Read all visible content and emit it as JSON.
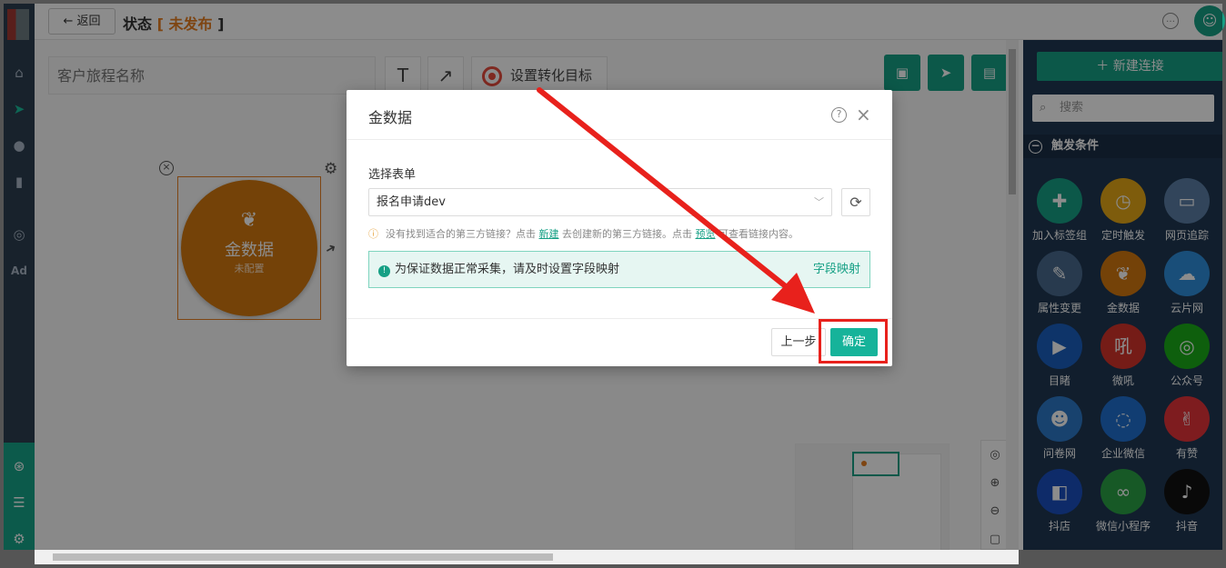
{
  "topbar": {
    "back_label": "返回",
    "title": "状态",
    "status": "未发布",
    "bracket_open": "[",
    "bracket_close": "]"
  },
  "toolbar": {
    "name_placeholder": "客户旅程名称",
    "text_tool": "T",
    "arrow_tool": "↗",
    "goal_label": "设置转化目标"
  },
  "node": {
    "title": "金数据",
    "subtitle": "未配置"
  },
  "right_panel": {
    "new_connection": "新建连接",
    "search_placeholder": "搜索",
    "section_title": "触发条件",
    "items": [
      {
        "label": "加入标签组",
        "icon": "user-plus-icon",
        "color": "#16a085"
      },
      {
        "label": "定时触发",
        "icon": "clock-icon",
        "color": "#e6a817"
      },
      {
        "label": "网页追踪",
        "icon": "browser-icon",
        "color": "#5b7fa6"
      },
      {
        "label": "属性变更",
        "icon": "edit-icon",
        "color": "#4a6b8f"
      },
      {
        "label": "金数据",
        "icon": "leaf-icon",
        "color": "#d4790f"
      },
      {
        "label": "云片网",
        "icon": "cloud-icon",
        "color": "#2f8fdc"
      },
      {
        "label": "目睹",
        "icon": "play-icon",
        "color": "#1a5fbf"
      },
      {
        "label": "微吼",
        "icon": "weihou-icon",
        "color": "#d6332b"
      },
      {
        "label": "公众号",
        "icon": "wechat-icon",
        "color": "#1aad19"
      },
      {
        "label": "问卷网",
        "icon": "survey-icon",
        "color": "#2c79c9"
      },
      {
        "label": "企业微信",
        "icon": "wecom-icon",
        "color": "#1f6fd0"
      },
      {
        "label": "有赞",
        "icon": "thumb-icon",
        "color": "#e5333a"
      },
      {
        "label": "抖店",
        "icon": "shop-icon",
        "color": "#1a4fbf"
      },
      {
        "label": "微信小程序",
        "icon": "miniprogram-icon",
        "color": "#2ba245"
      },
      {
        "label": "抖音",
        "icon": "tiktok-icon",
        "color": "#111111"
      }
    ]
  },
  "modal": {
    "title": "金数据",
    "select_label": "选择表单",
    "select_value": "报名申请dev",
    "tip_a": "没有找到适合的第三方链接？点击",
    "tip_new": "新建",
    "tip_b": "去创建新的第三方链接。",
    "tip_c": "点击",
    "tip_preview": "预览",
    "tip_d": "可查看链接内容。",
    "notice": "为保证数据正常采集，请及时设置字段映射",
    "field_mapping": "字段映射",
    "prev_label": "上一步",
    "ok_label": "确定"
  },
  "sidebar": {
    "ad_label": "Ad"
  }
}
